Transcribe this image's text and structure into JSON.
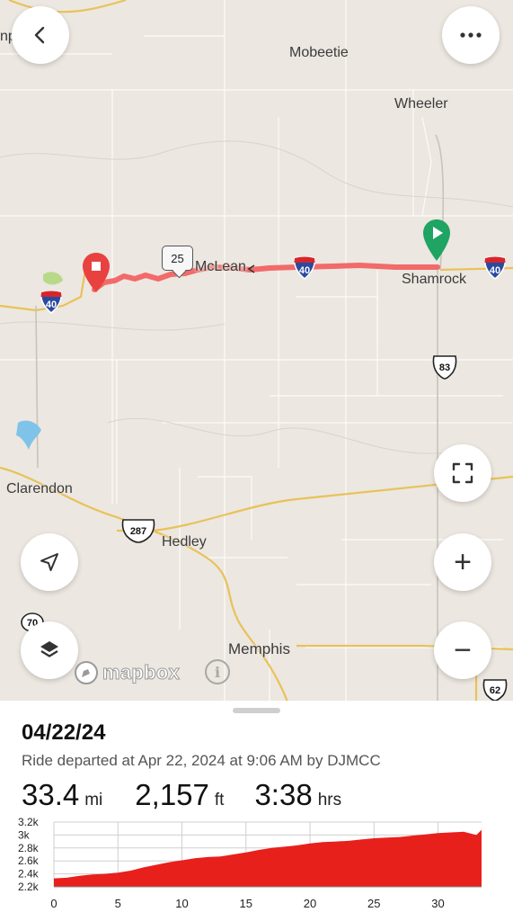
{
  "map": {
    "places": {
      "mobeetie": "Mobeetie",
      "wheeler": "Wheeler",
      "mclean": "McLean",
      "shamrock": "Shamrock",
      "clarendon": "Clarendon",
      "hedley": "Hedley",
      "memphis": "Memphis",
      "edge_left": "np"
    },
    "shields": {
      "i40_left": "40",
      "i40_mid": "40",
      "i40_right": "40",
      "us83": "83",
      "us287": "287",
      "us62": "62",
      "sh70": "70"
    },
    "mile_marker": "25",
    "attribution": "mapbox",
    "route_color": "#f26a6a",
    "start_color": "#1fa463",
    "end_color": "#e8413f"
  },
  "controls": {
    "back": "back-arrow-icon",
    "more": "more-dots-icon",
    "fullscreen": "fullscreen-icon",
    "locate": "navigation-arrow-icon",
    "layers": "layers-icon",
    "zoom_in": "+",
    "zoom_out": "−"
  },
  "ride": {
    "title": "04/22/24",
    "subtitle": "Ride departed at Apr 22, 2024 at 9:06 AM by DJMCC",
    "distance": "33.4",
    "distance_unit": "mi",
    "elevation": "2,157",
    "elevation_unit": "ft",
    "duration": "3:38",
    "duration_unit": "hrs"
  },
  "chart_data": {
    "type": "area",
    "xlabel": "",
    "ylabel": "",
    "x_ticks": [
      "0",
      "5",
      "10",
      "15",
      "20",
      "25",
      "30"
    ],
    "y_ticks": [
      "3.2k",
      "3k",
      "2.8k",
      "2.6k",
      "2.4k",
      "2.2k"
    ],
    "xlim": [
      0,
      33.4
    ],
    "ylim": [
      2200,
      3200
    ],
    "fill_color": "#e8201c",
    "series": [
      {
        "x": [
          0,
          1,
          2,
          3,
          4,
          5,
          6,
          7,
          8,
          9,
          10,
          11,
          12,
          13,
          14,
          15,
          16,
          17,
          18,
          19,
          20,
          21,
          22,
          23,
          24,
          25,
          26,
          27,
          28,
          29,
          30,
          31,
          32,
          33,
          33.4
        ],
        "values": [
          2330,
          2340,
          2370,
          2390,
          2400,
          2420,
          2450,
          2500,
          2540,
          2580,
          2610,
          2640,
          2660,
          2670,
          2700,
          2730,
          2770,
          2800,
          2820,
          2840,
          2870,
          2890,
          2900,
          2910,
          2930,
          2950,
          2960,
          2970,
          2990,
          3010,
          3030,
          3040,
          3050,
          3000,
          3080
        ]
      }
    ]
  }
}
